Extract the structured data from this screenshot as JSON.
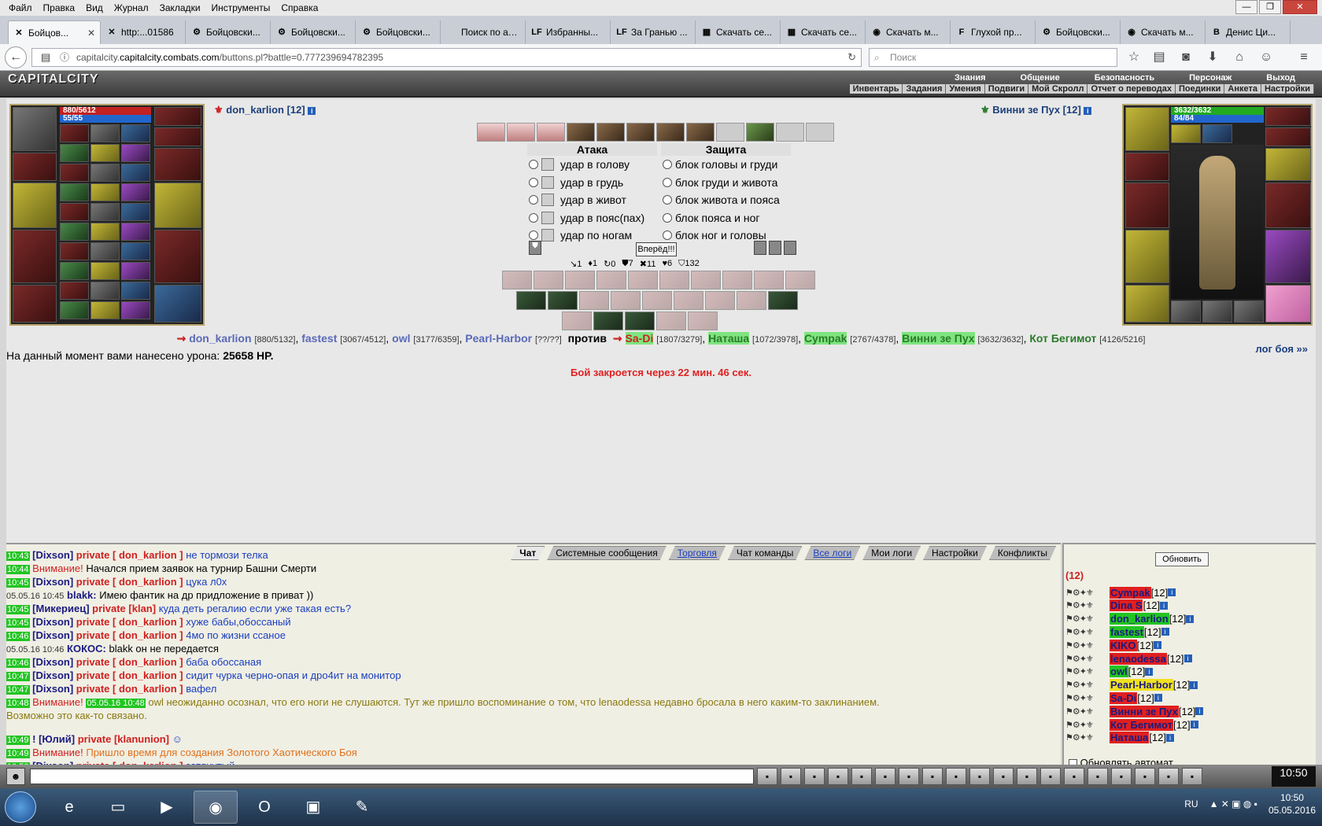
{
  "browser": {
    "menu": [
      "Файл",
      "Правка",
      "Вид",
      "Журнал",
      "Закладки",
      "Инструменты",
      "Справка"
    ],
    "tabs": [
      {
        "label": "Бойцов...",
        "icon": "✕",
        "active": true
      },
      {
        "label": "http:...01586",
        "icon": "✕"
      },
      {
        "label": "Бойцовски...",
        "icon": "⚙"
      },
      {
        "label": "Бойцовски...",
        "icon": "⚙"
      },
      {
        "label": "Бойцовски...",
        "icon": "⚙"
      },
      {
        "label": "Поиск по аукц...",
        "icon": ""
      },
      {
        "label": "Избранны...",
        "icon": "LF"
      },
      {
        "label": "За Гранью ...",
        "icon": "LF"
      },
      {
        "label": "Скачать се...",
        "icon": "▦"
      },
      {
        "label": "Скачать се...",
        "icon": "▦"
      },
      {
        "label": "Скачать м...",
        "icon": "◉"
      },
      {
        "label": "Глухой пр...",
        "icon": "F"
      },
      {
        "label": "Бойцовски...",
        "icon": "⚙"
      },
      {
        "label": "Скачать м...",
        "icon": "◉"
      },
      {
        "label": "Денис Ци...",
        "icon": "B"
      }
    ],
    "url_host": "capitalcity.combats.com",
    "url_path": "/buttons.pl?battle=0.777239694782395",
    "url_prefix": "capitalcity.",
    "search_placeholder": "Поиск"
  },
  "game": {
    "logo": "CAPITALCITY",
    "top_menu": [
      "Знания",
      "Общение",
      "Безопасность",
      "Персонаж",
      "Выход"
    ],
    "sub_menu": [
      "Инвентарь",
      "Задания",
      "Умения",
      "Подвиги",
      "Мой Скролл",
      "Отчет о переводах",
      "Поединки",
      "Анкета",
      "Настройки"
    ],
    "player": {
      "name": "don_karlion [12]",
      "hp": "880/5612",
      "mana": "55/55"
    },
    "enemy": {
      "name": "Винни зе Пух [12]",
      "hp": "3632/3632",
      "mana": "84/84"
    },
    "attack_header": "Атака",
    "defense_header": "Защита",
    "attacks": [
      "удар в голову",
      "удар в грудь",
      "удар в живот",
      "удар в пояс(пах)",
      "удар по ногам"
    ],
    "blocks": [
      "блок головы и груди",
      "блок груди и живота",
      "блок живота и пояса",
      "блок пояса и ног",
      "блок ног и головы"
    ],
    "go_button": "Вперёд!!!",
    "stats": [
      "↘1",
      "♦1",
      "↻0",
      "⛊7",
      "✖11",
      "♥6",
      "⛉132"
    ],
    "team_left": [
      {
        "name": "don_karlion",
        "hp": "[880/5132]"
      },
      {
        "name": "fastest",
        "hp": "[3067/4512]"
      },
      {
        "name": "owl",
        "hp": "[3177/6359]"
      },
      {
        "name": "Pearl-Harbor",
        "hp": "[??/??]"
      }
    ],
    "versus": "против",
    "team_right": [
      {
        "name": "Sa-Di",
        "hp": "[1807/3279]",
        "style": "hl2"
      },
      {
        "name": "Наташа",
        "hp": "[1072/3978]",
        "style": "hl"
      },
      {
        "name": "Cympak",
        "hp": "[2767/4378]",
        "style": "hl"
      },
      {
        "name": "Винни зе Пух",
        "hp": "[3632/3632]",
        "style": "hl"
      },
      {
        "name": "Кот Бегимот",
        "hp": "[4126/5216]",
        "style": ""
      }
    ],
    "damage_label": "На данный момент вами нанесено урона:",
    "damage_value": "25658 HP.",
    "battle_log_link": "лог боя »»",
    "close_timer": "Бой закроется через 22 мин. 46 сек."
  },
  "chat": {
    "tabs": [
      {
        "label": "Чат",
        "style": "active"
      },
      {
        "label": "Системные сообщения",
        "style": ""
      },
      {
        "label": "Торговля",
        "style": "link"
      },
      {
        "label": "Чат команды",
        "style": ""
      },
      {
        "label": "Все логи",
        "style": "link"
      },
      {
        "label": "Мои логи",
        "style": ""
      },
      {
        "label": "Настройки",
        "style": ""
      },
      {
        "label": "Конфликты",
        "style": ""
      }
    ],
    "lines": [
      {
        "ts": "10:43",
        "nick": "[Dixson]",
        "priv": "private [ don_karlion ]",
        "text": "не тормози телка",
        "cls": "msg"
      },
      {
        "ts": "10:44",
        "warn": "Внимание!",
        "text": "Начался прием заявок на турнир Башни Смерти",
        "cls": ""
      },
      {
        "ts": "10:45",
        "nick": "[Dixson]",
        "priv": "private [ don_karlion ]",
        "text": "цука л0х",
        "cls": "msg"
      },
      {
        "ts2": "05.05.16 10:45",
        "nick": "blakk:",
        "text": "Имею фантик на др придложение в приват ))",
        "cls": "",
        "plainnick": true
      },
      {
        "ts": "10:45",
        "nick": "[Микериец]",
        "priv": "private [klan]",
        "text": "куда деть регалию если уже такая есть?",
        "cls": "msg"
      },
      {
        "ts": "10:45",
        "nick": "[Dixson]",
        "priv": "private [ don_karlion ]",
        "text": "хуже бабы,обоссаный",
        "cls": "msg"
      },
      {
        "ts": "10:46",
        "nick": "[Dixson]",
        "priv": "private [ don_karlion ]",
        "text": "4мо по жизни ссаное",
        "cls": "msg"
      },
      {
        "ts2": "05.05.16 10:46",
        "nick": "КОКОС:",
        "text": "blakk он не передается",
        "cls": "",
        "plainnick": true
      },
      {
        "ts": "10:46",
        "nick": "[Dixson]",
        "priv": "private [ don_karlion ]",
        "text": "баба обоссаная",
        "cls": "msg"
      },
      {
        "ts": "10:47",
        "nick": "[Dixson]",
        "priv": "private [ don_karlion ]",
        "text": "сидит чурка черно-опая и дро4ит на монитор",
        "cls": "msg"
      },
      {
        "ts": "10:47",
        "nick": "[Dixson]",
        "priv": "private [ don_karlion ]",
        "text": "вафел",
        "cls": "msg"
      },
      {
        "ts": "10:48",
        "warn": "Внимание!",
        "ts_inner": "05.05.16 10:48",
        "text": "owl неожиданно осознал, что его ноги не слушаются. Тут же пришло воспоминание о том, что lenaodessa недавно бросала в него каким-то заклинанием.",
        "cls": "gold"
      },
      {
        "text": "Возможно это как-то связано.",
        "cls": "gold"
      },
      {
        "text": "",
        "cls": ""
      },
      {
        "ts": "10:49",
        "nick": "! [Юлий]",
        "priv": "private [klanunion]",
        "text": "☺",
        "cls": "msg"
      },
      {
        "ts": "10:49",
        "warn": "Внимание!",
        "text": "Пришло время для создания Золотого Хаотического Боя",
        "cls": "orange"
      },
      {
        "ts": "10:50",
        "nick": "[Dixson]",
        "priv": "private [ don_karlion ]",
        "text": "затянутый",
        "cls": "msg"
      }
    ]
  },
  "online": {
    "refresh": "Обновить",
    "count": "(12)",
    "users": [
      {
        "name": "Cympak",
        "level": "[12]",
        "bg": "bg-red"
      },
      {
        "name": "Dina S",
        "level": "[12]",
        "bg": "bg-red"
      },
      {
        "name": "don_karlion",
        "level": "[12]",
        "bg": "bg-green"
      },
      {
        "name": "fastest",
        "level": "[12]",
        "bg": "bg-green"
      },
      {
        "name": "KIKO",
        "level": "[12]",
        "bg": "bg-red"
      },
      {
        "name": "lenaodessa",
        "level": "[12]",
        "bg": "bg-red"
      },
      {
        "name": "owl",
        "level": "[12]",
        "bg": "bg-green"
      },
      {
        "name": "Pearl-Harbor",
        "level": "[12]",
        "bg": "bg-yellow"
      },
      {
        "name": "Sa-Di",
        "level": "[12]",
        "bg": "bg-red"
      },
      {
        "name": "Винни зе Пух",
        "level": "[12]",
        "bg": "bg-red"
      },
      {
        "name": "Кот Бегимот",
        "level": "[12]",
        "bg": "bg-red"
      },
      {
        "name": "Наташа",
        "level": "[12]",
        "bg": "bg-red"
      }
    ],
    "auto_refresh": "Обновлять автомат"
  },
  "clock": {
    "game": "10:50",
    "sys_time": "10:50",
    "sys_date": "05.05.2016",
    "lang": "RU"
  }
}
